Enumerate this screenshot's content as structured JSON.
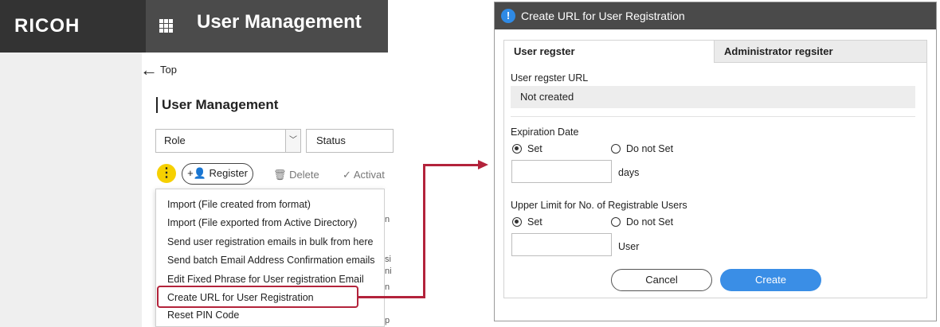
{
  "left_app": {
    "brand": "RICOH",
    "title": "User Management",
    "back_label": "Top",
    "page_title": "User Management",
    "filters": {
      "role": "Role",
      "status": "Status"
    },
    "toolbar": {
      "register": "Register",
      "delete": "Delete",
      "activate": "Activat"
    },
    "menu_items": [
      "Import (File created from format)",
      "Import (File exported from Active Directory)",
      "Send user registration emails in bulk from here",
      "Send batch Email Address Confirmation emails",
      "Edit Fixed Phrase for User registration Email",
      "Create URL for User Registration",
      "Reset PIN Code"
    ],
    "clipped_chars": [
      "n",
      "si",
      "ni",
      "n",
      "p"
    ]
  },
  "dialog": {
    "title": "Create URL for User Registration",
    "tabs": [
      "User regster",
      "Administrator regsiter"
    ],
    "url_label": "User regster URL",
    "url_value": "Not created",
    "expiration": {
      "label": "Expiration Date",
      "set": "Set",
      "not_set": "Do not Set",
      "unit": "days"
    },
    "upper_limit": {
      "label": "Upper Limit for No. of Registrable Users",
      "set": "Set",
      "not_set": "Do not Set",
      "unit": "User"
    },
    "cancel": "Cancel",
    "create": "Create"
  },
  "colors": {
    "accent": "#b3233b",
    "primary": "#3a8ee6",
    "header": "#4b4b4b",
    "kebab": "#f6d000"
  }
}
